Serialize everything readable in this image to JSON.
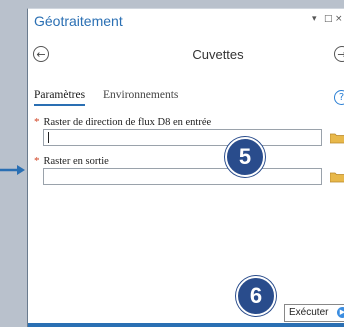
{
  "window": {
    "title": "Géotraitement",
    "controls": {
      "pin": "▾",
      "restore": "□",
      "close": "×"
    }
  },
  "tool": {
    "name": "Cuvettes",
    "back_icon": "arrow-left-circle-icon",
    "forward_icon": "arrow-right-circle-icon"
  },
  "tabs": [
    {
      "label": "Paramètres",
      "active": true
    },
    {
      "label": "Environnements",
      "active": false
    }
  ],
  "help_icon": "?",
  "parameters": [
    {
      "required_mark": "*",
      "label": "Raster de direction de flux D8 en entrée",
      "value": ""
    },
    {
      "required_mark": "*",
      "label": "Raster en sortie",
      "value": ""
    }
  ],
  "callouts": {
    "step_5": "5",
    "step_6": "6"
  },
  "run_button": {
    "label": "Exécuter",
    "icon": "▶"
  },
  "colors": {
    "accent": "#2a6fb3",
    "callout": "#294c8c",
    "required": "#d04020",
    "folder": "#e8b84a"
  }
}
